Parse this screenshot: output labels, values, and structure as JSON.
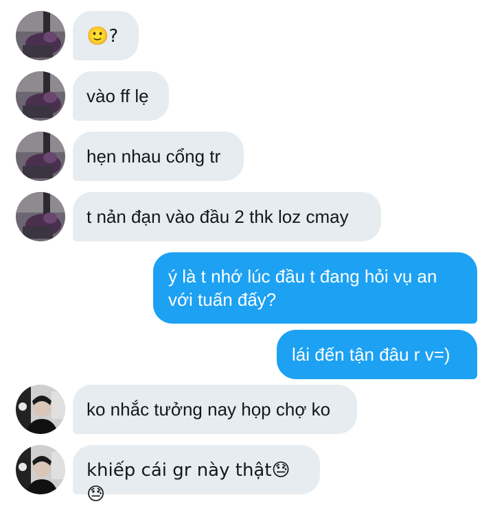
{
  "conversation": {
    "messages": [
      {
        "from": "other",
        "avatar": "room-photo",
        "text": "🙂?"
      },
      {
        "from": "other",
        "avatar": "room-photo",
        "text": "vào ff lẹ"
      },
      {
        "from": "other",
        "avatar": "room-photo",
        "text": "hẹn nhau cổng tr"
      },
      {
        "from": "other",
        "avatar": "room-photo",
        "text": "t nản đạn vào đầu 2 thk loz cmay"
      },
      {
        "from": "me",
        "text": "ý là t nhớ lúc đầu t đang hỏi vụ an với tuấn đấy?"
      },
      {
        "from": "me",
        "text": "lái đến tận đâu r v=)"
      },
      {
        "from": "other",
        "avatar": "person-photo",
        "text": "ko nhắc tưởng nay họp chợ ko"
      },
      {
        "from": "other",
        "avatar": "person-photo",
        "text": "khiếp cái gr này thật😓😓"
      }
    ]
  },
  "colors": {
    "incoming_bubble": "#e6ecf0",
    "outgoing_bubble": "#1da1f2",
    "incoming_text": "#14171a",
    "outgoing_text": "#ffffff"
  }
}
